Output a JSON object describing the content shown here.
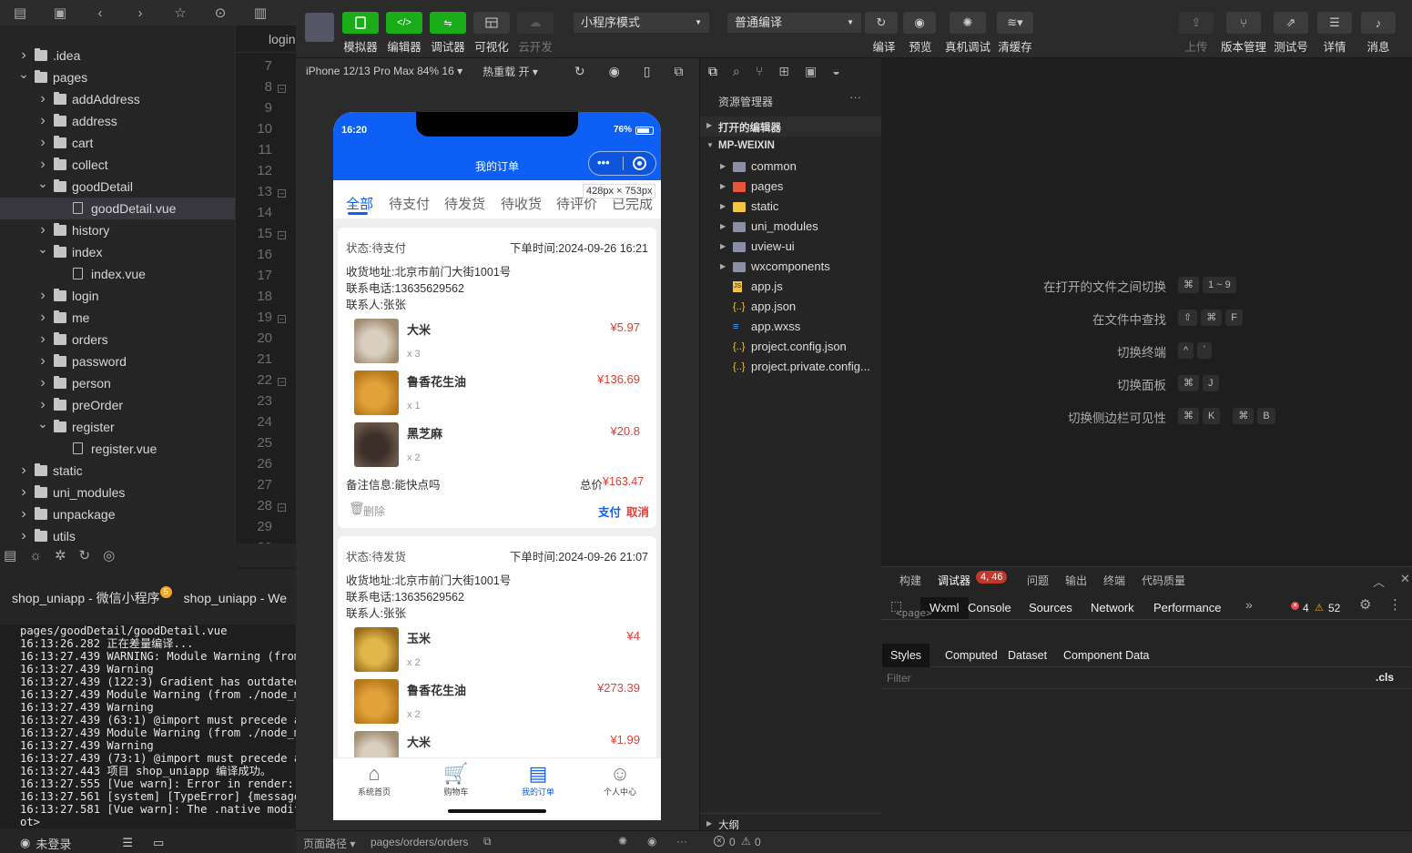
{
  "left_panel": {
    "editor_tab": "login",
    "tree": [
      {
        "label": ".idea",
        "depth": 0,
        "open": false,
        "type": "folder"
      },
      {
        "label": "pages",
        "depth": 0,
        "open": true,
        "type": "folder"
      },
      {
        "label": "addAddress",
        "depth": 1,
        "open": false,
        "type": "folder"
      },
      {
        "label": "address",
        "depth": 1,
        "open": false,
        "type": "folder"
      },
      {
        "label": "cart",
        "depth": 1,
        "open": false,
        "type": "folder"
      },
      {
        "label": "collect",
        "depth": 1,
        "open": false,
        "type": "folder"
      },
      {
        "label": "goodDetail",
        "depth": 1,
        "open": true,
        "type": "folder"
      },
      {
        "label": "goodDetail.vue",
        "depth": 2,
        "type": "file",
        "selected": true
      },
      {
        "label": "history",
        "depth": 1,
        "open": false,
        "type": "folder"
      },
      {
        "label": "index",
        "depth": 1,
        "open": true,
        "type": "folder"
      },
      {
        "label": "index.vue",
        "depth": 2,
        "type": "file"
      },
      {
        "label": "login",
        "depth": 1,
        "open": false,
        "type": "folder"
      },
      {
        "label": "me",
        "depth": 1,
        "open": false,
        "type": "folder"
      },
      {
        "label": "orders",
        "depth": 1,
        "open": false,
        "type": "folder"
      },
      {
        "label": "password",
        "depth": 1,
        "open": false,
        "type": "folder"
      },
      {
        "label": "person",
        "depth": 1,
        "open": false,
        "type": "folder"
      },
      {
        "label": "preOrder",
        "depth": 1,
        "open": false,
        "type": "folder"
      },
      {
        "label": "register",
        "depth": 1,
        "open": true,
        "type": "folder"
      },
      {
        "label": "register.vue",
        "depth": 2,
        "type": "file"
      },
      {
        "label": "static",
        "depth": 0,
        "open": false,
        "type": "folder"
      },
      {
        "label": "uni_modules",
        "depth": 0,
        "open": false,
        "type": "folder"
      },
      {
        "label": "unpackage",
        "depth": 0,
        "open": false,
        "type": "folder"
      },
      {
        "label": "utils",
        "depth": 0,
        "open": false,
        "type": "folder"
      }
    ],
    "line_numbers": [
      "7",
      "8",
      "9",
      "10",
      "11",
      "12",
      "13",
      "14",
      "15",
      "16",
      "17",
      "18",
      "19",
      "20",
      "21",
      "22",
      "23",
      "24",
      "25",
      "26",
      "27",
      "28",
      "29",
      "30"
    ],
    "fold_lines": [
      "8",
      "13",
      "15",
      "19",
      "22",
      "28"
    ],
    "console_tabs": [
      {
        "label": "shop_uniapp - 微信小程序",
        "badge": "5"
      },
      {
        "label": "shop_uniapp - We"
      }
    ],
    "console_lines": [
      "pages/goodDetail/goodDetail.vue",
      "16:13:26.282 正在差量编译...",
      "16:13:27.439 WARNING: Module Warning (from",
      "16:13:27.439 Warning",
      "16:13:27.439 (122:3) Gradient has outdated",
      "16:13:27.439 Module Warning (from ./node_m",
      "16:13:27.439 Warning",
      "16:13:27.439 (63:1) @import must precede a",
      "16:13:27.439 Module Warning (from ./node_m",
      "16:13:27.439 Warning",
      "16:13:27.439 (73:1) @import must precede a",
      "16:13:27.443 项目 shop_uniapp 编译成功。",
      "16:13:27.555 [Vue warn]: Error in render:",
      "16:13:27.561 [system] [TypeError] {message",
      "16:13:27.581 [Vue warn]: The .native modif",
      "ot>"
    ],
    "login_status": "未登录"
  },
  "toolbar": {
    "buttons": [
      {
        "label": "模拟器"
      },
      {
        "label": "编辑器"
      },
      {
        "label": "调试器"
      },
      {
        "label": "可视化"
      },
      {
        "label": "云开发"
      }
    ],
    "mode_select": "小程序模式",
    "compile_select": "普通编译",
    "right_buttons": [
      {
        "label": "编译"
      },
      {
        "label": "预览"
      },
      {
        "label": "真机调试"
      },
      {
        "label": "清缓存"
      }
    ],
    "far_right": [
      {
        "label": "上传"
      },
      {
        "label": "版本管理"
      },
      {
        "label": "测试号"
      },
      {
        "label": "详情"
      },
      {
        "label": "消息"
      }
    ]
  },
  "simulator": {
    "device": "iPhone 12/13 Pro Max 84% 16",
    "hot_reload": "热重载 开",
    "size_tip": "428px × 753px",
    "time": "16:20",
    "battery": "76%",
    "page_title": "我的订单",
    "tabs": [
      "全部",
      "待支付",
      "待发货",
      "待收货",
      "待评价",
      "已完成"
    ],
    "orders": [
      {
        "status": "状态:待支付",
        "time": "下单时间:2024-09-26 16:21",
        "address": "收货地址:北京市前门大街1001号",
        "phone": "联系电话:13635629562",
        "contact": "联系人:张张",
        "items": [
          {
            "name": "大米",
            "qty": "x 3",
            "price": "¥5.97"
          },
          {
            "name": "鲁香花生油",
            "qty": "x 1",
            "price": "¥136.69"
          },
          {
            "name": "黑芝麻",
            "qty": "x 2",
            "price": "¥20.8"
          }
        ],
        "note": "备注信息:能快点吗",
        "total_label": "总价",
        "total": "¥163.47",
        "delete": "删除",
        "pay": "支付",
        "cancel": "取消"
      },
      {
        "status": "状态:待发货",
        "time": "下单时间:2024-09-26 21:07",
        "address": "收货地址:北京市前门大街1001号",
        "phone": "联系电话:13635629562",
        "contact": "联系人:张张",
        "items": [
          {
            "name": "玉米",
            "qty": "x 2",
            "price": "¥4"
          },
          {
            "name": "鲁香花生油",
            "qty": "x 2",
            "price": "¥273.39"
          },
          {
            "name": "大米",
            "qty": "",
            "price": "¥1.99"
          }
        ]
      }
    ],
    "tabbar": [
      "系统首页",
      "购物车",
      "我的订单",
      "个人中心"
    ],
    "page_path_label": "页面路径",
    "page_path": "pages/orders/orders"
  },
  "explorer": {
    "title": "资源管理器",
    "open_editors": "打开的编辑器",
    "project": "MP-WEIXIN",
    "items": [
      {
        "label": "common",
        "kind": "folder",
        "color": "#8a8fa6"
      },
      {
        "label": "pages",
        "kind": "folder",
        "color": "#e8553d"
      },
      {
        "label": "static",
        "kind": "folder",
        "color": "#f4c542"
      },
      {
        "label": "uni_modules",
        "kind": "folder",
        "color": "#8a8fa6"
      },
      {
        "label": "uview-ui",
        "kind": "folder",
        "color": "#8a8fa6"
      },
      {
        "label": "wxcomponents",
        "kind": "folder",
        "color": "#8a8fa6"
      },
      {
        "label": "app.js",
        "kind": "js",
        "color": "#f4c542"
      },
      {
        "label": "app.json",
        "kind": "json",
        "color": "#f4c542"
      },
      {
        "label": "app.wxss",
        "kind": "css",
        "color": "#4aa3f0"
      },
      {
        "label": "project.config.json",
        "kind": "json",
        "color": "#f4c542"
      },
      {
        "label": "project.private.config...",
        "kind": "json",
        "color": "#f4c542"
      }
    ],
    "outline": "大纲",
    "errors": "0",
    "warnings": "0"
  },
  "shortcuts": [
    {
      "label": "在打开的文件之间切换",
      "keys": [
        "⌘",
        "1 ~ 9"
      ]
    },
    {
      "label": "在文件中查找",
      "keys": [
        "⇧",
        "⌘",
        "F"
      ]
    },
    {
      "label": "切换终端",
      "keys": [
        "^",
        "`"
      ]
    },
    {
      "label": "切换面板",
      "keys": [
        "⌘",
        "J"
      ]
    },
    {
      "label": "切换侧边栏可见性",
      "keys": [
        "⌘",
        "K",
        "⌘",
        "B"
      ]
    }
  ],
  "devtools": {
    "top_tabs": [
      "构建",
      "调试器",
      "问题",
      "输出",
      "终端",
      "代码质量"
    ],
    "debugger_badge": "4, 46",
    "tabs": [
      "Wxml",
      "Console",
      "Sources",
      "Network",
      "Performance"
    ],
    "errors": "4",
    "warnings": "52",
    "style_tabs": [
      "Styles",
      "Computed",
      "Dataset",
      "Component Data"
    ],
    "filter_placeholder": "Filter",
    "cls": ".cls",
    "page_tag": "<page>"
  }
}
